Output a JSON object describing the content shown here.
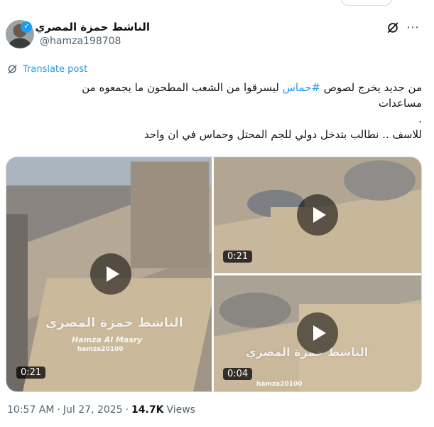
{
  "author": {
    "display_name": "الناشط حمزة المصري",
    "handle": "@hamza198708",
    "verified": true,
    "verified_color": "#1d9bf0"
  },
  "actions": {
    "grok_icon": "grok-icon",
    "more_icon": "more-icon"
  },
  "translate": {
    "label": "Translate post",
    "icon": "globe-translate-icon"
  },
  "tweet": {
    "line1_before": "من جديد يخرج لصوص ",
    "hashtag": "#حماس",
    "line1_after": " ليسرقوا من الشعب المطحون ما يجمعوه من",
    "line2": "مساعدات",
    "line3": ".",
    "line4": "للاسف .. نطالب بتدخل دولي للجم المحتل وحماس في ان واحد"
  },
  "media": {
    "videos": [
      {
        "duration": "0:21",
        "watermark": "الناشط حمزة المصري",
        "watermark_latin": "Hamza Al Masry",
        "watermark_handle": "hamza20100"
      },
      {
        "duration": "0:21"
      },
      {
        "duration": "0:04",
        "watermark": "الناشط حمزة المصري",
        "watermark_handle": "hamza20100"
      }
    ]
  },
  "meta": {
    "time": "10:57 AM",
    "separator": "·",
    "date": "Jul 27, 2025",
    "separator2": "·",
    "views_count": "14.7K",
    "views_label": "Views"
  },
  "colors": {
    "link": "#1d9bf0",
    "secondary_text": "#536471",
    "primary_text": "#0f1419"
  }
}
